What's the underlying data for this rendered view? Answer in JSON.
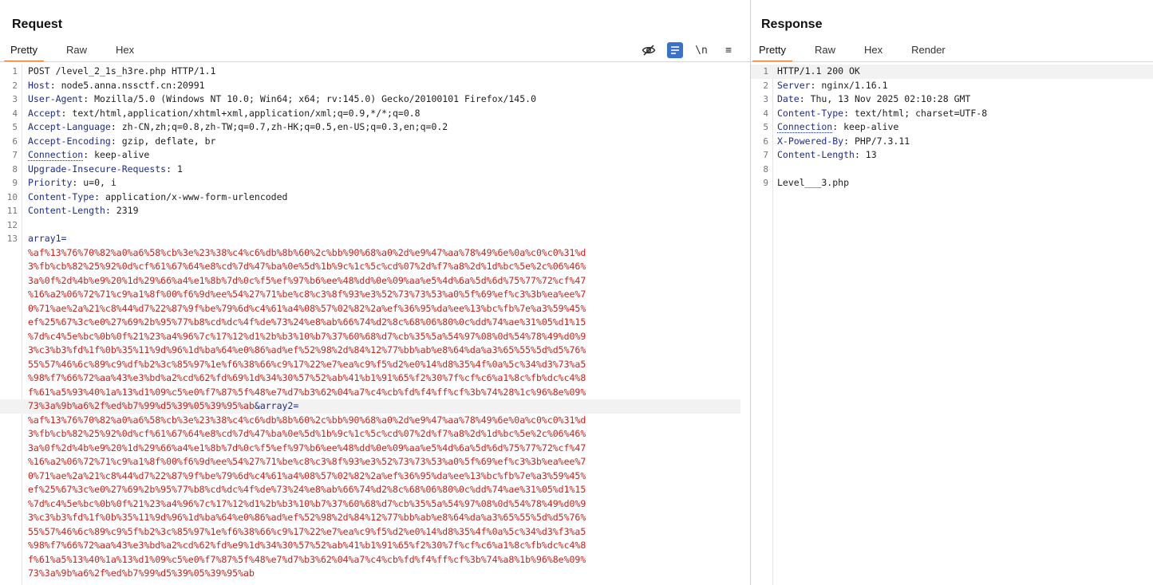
{
  "request": {
    "title": "Request",
    "tabs": [
      "Pretty",
      "Raw",
      "Hex"
    ],
    "active_tab": "Pretty",
    "toolbar": {
      "wrap_glyph": "\\n",
      "menu_glyph": "≡"
    },
    "headers": [
      {
        "n": "1",
        "key": "",
        "value": "POST /level_2_1s_h3re.php HTTP/1.1"
      },
      {
        "n": "2",
        "key": "Host",
        "value": " node5.anna.nssctf.cn:20991"
      },
      {
        "n": "3",
        "key": "User-Agent",
        "value": " Mozilla/5.0 (Windows NT 10.0; Win64; x64; rv:145.0) Gecko/20100101 Firefox/145.0"
      },
      {
        "n": "4",
        "key": "Accept",
        "value": " text/html,application/xhtml+xml,application/xml;q=0.9,*/*;q=0.8"
      },
      {
        "n": "5",
        "key": "Accept-Language",
        "value": " zh-CN,zh;q=0.8,zh-TW;q=0.7,zh-HK;q=0.5,en-US;q=0.3,en;q=0.2"
      },
      {
        "n": "6",
        "key": "Accept-Encoding",
        "value": " gzip, deflate, br"
      },
      {
        "n": "7",
        "key": "Connection",
        "value": " keep-alive"
      },
      {
        "n": "8",
        "key": "Upgrade-Insecure-Requests",
        "value": " 1"
      },
      {
        "n": "9",
        "key": "Priority",
        "value": " u=0, i"
      },
      {
        "n": "10",
        "key": "Content-Type",
        "value": " application/x-www-form-urlencoded"
      },
      {
        "n": "11",
        "key": "Content-Length",
        "value": " 2319"
      },
      {
        "n": "12",
        "key": "",
        "value": ""
      }
    ],
    "body_line_number": "13",
    "body_first_key": "array1=",
    "body_separator": "&",
    "body_second_key": "array2=",
    "array1_lines": [
      "%af%13%76%70%82%a0%a6%58%cb%3e%23%38%c4%c6%db%8b%60%2c%bb%90%68%a0%2d%e9%47%aa%78%49%6e%0a%c0%c0%31%d",
      "3%fb%cb%82%25%92%0d%cf%61%67%64%e8%cd%7d%47%ba%0e%5d%1b%9c%1c%5c%cd%07%2d%f7%a8%2d%1d%bc%5e%2c%06%46%",
      "3a%0f%2d%4b%e9%20%1d%29%66%a4%e1%8b%7d%0c%f5%ef%97%b6%ee%48%dd%0e%09%aa%e5%4d%6a%5d%6d%75%77%72%cf%47",
      "%16%a2%06%72%71%c9%a1%8f%00%f6%9d%ee%54%27%71%be%c8%c3%8f%93%e3%52%73%73%53%a0%5f%69%ef%c3%3b%ea%ee%7",
      "0%71%ae%2a%21%c8%44%d7%22%87%9f%be%79%6d%c4%61%a4%08%57%02%82%2a%ef%36%95%da%ee%13%bc%fb%7e%a3%59%45%",
      "ef%25%67%3c%e0%27%69%2b%95%77%b8%cd%dc%4f%de%73%24%e8%ab%66%74%d2%8c%68%06%80%0c%dd%74%ae%31%05%d1%15",
      "%7d%c4%5e%bc%0b%0f%21%23%a4%96%7c%17%12%d1%2b%b3%10%b7%37%60%68%d7%cb%35%5a%54%97%08%0d%54%78%49%d0%9",
      "3%c3%b3%fd%1f%0b%35%11%9d%96%1d%ba%64%e0%86%ad%ef%52%98%2d%84%12%77%bb%ab%e8%64%da%a3%65%55%5d%d5%76%",
      "55%57%46%6c%89%c9%df%b2%3c%85%97%1e%f6%38%66%c9%17%22%e7%ea%c9%f5%d2%e0%14%d8%35%4f%0a%5c%34%d3%73%a5",
      "%98%f7%66%72%aa%43%e3%bd%a2%cd%62%fd%69%1d%34%30%57%52%ab%41%b1%91%65%f2%30%7f%cf%c6%a1%8c%fb%dc%c4%8",
      "f%61%a5%93%40%1a%13%d1%09%c5%e0%f7%87%5f%48%e7%d7%b3%62%04%a7%c4%cb%fd%f4%ff%cf%3b%74%28%1c%96%8e%09%",
      "73%3a%9b%a6%2f%ed%b7%99%d5%39%05%39%95%ab"
    ],
    "array2_lines": [
      "%af%13%76%70%82%a0%a6%58%cb%3e%23%38%c4%c6%db%8b%60%2c%bb%90%68%a0%2d%e9%47%aa%78%49%6e%0a%c0%c0%31%d",
      "3%fb%cb%82%25%92%0d%cf%61%67%64%e8%cd%7d%47%ba%0e%5d%1b%9c%1c%5c%cd%07%2d%f7%a8%2d%1d%bc%5e%2c%06%46%",
      "3a%0f%2d%4b%e9%20%1d%29%66%a4%e1%8b%7d%0c%f5%ef%97%b6%ee%48%dd%0e%09%aa%e5%4d%6a%5d%6d%75%77%72%cf%47",
      "%16%a2%06%72%71%c9%a1%8f%00%f6%9d%ee%54%27%71%be%c8%c3%8f%93%e3%52%73%73%53%a0%5f%69%ef%c3%3b%ea%ee%7",
      "0%71%ae%2a%21%c8%44%d7%22%87%9f%be%79%6d%c4%61%a4%08%57%02%82%2a%ef%36%95%da%ee%13%bc%fb%7e%a3%59%45%",
      "ef%25%67%3c%e0%27%69%2b%95%77%b8%cd%dc%4f%de%73%24%e8%ab%66%74%d2%8c%68%06%80%0c%dd%74%ae%31%05%d1%15",
      "%7d%c4%5e%bc%0b%0f%21%23%a4%96%7c%17%12%d1%2b%b3%10%b7%37%60%68%d7%cb%35%5a%54%97%08%0d%54%78%49%d0%9",
      "3%c3%b3%fd%1f%0b%35%11%9d%96%1d%ba%64%e0%86%ad%ef%52%98%2d%84%12%77%bb%ab%e8%64%da%a3%65%55%5d%d5%76%",
      "55%57%46%6c%89%c9%5f%b2%3c%85%97%1e%f6%38%66%c9%17%22%e7%ea%c9%f5%d2%e0%14%d8%35%4f%0a%5c%34%d3%f3%a5",
      "%98%f7%66%72%aa%43%e3%bd%a2%cd%62%fd%e9%1d%34%30%57%52%ab%41%b1%91%65%f2%30%7f%cf%c6%a1%8c%fb%dc%c4%8",
      "f%61%a5%13%40%1a%13%d1%09%c5%e0%f7%87%5f%48%e7%d7%b3%62%04%a7%c4%cb%fd%f4%ff%cf%3b%74%a8%1b%96%8e%09%",
      "73%3a%9b%a6%2f%ed%b7%99%d5%39%05%39%95%ab"
    ]
  },
  "response": {
    "title": "Response",
    "tabs": [
      "Pretty",
      "Raw",
      "Hex",
      "Render"
    ],
    "active_tab": "Pretty",
    "lines": [
      {
        "n": "1",
        "key": "",
        "value": "HTTP/1.1 200 OK"
      },
      {
        "n": "2",
        "key": "Server",
        "value": " nginx/1.16.1"
      },
      {
        "n": "3",
        "key": "Date",
        "value": " Thu, 13 Nov 2025 02:10:28 GMT"
      },
      {
        "n": "4",
        "key": "Content-Type",
        "value": " text/html; charset=UTF-8"
      },
      {
        "n": "5",
        "key": "Connection",
        "value": " keep-alive"
      },
      {
        "n": "6",
        "key": "X-Powered-By",
        "value": " PHP/7.3.11"
      },
      {
        "n": "7",
        "key": "Content-Length",
        "value": " 13"
      },
      {
        "n": "8",
        "key": "",
        "value": ""
      },
      {
        "n": "9",
        "key": "",
        "value": "Level___3.php"
      }
    ]
  },
  "colors": {
    "accent": "#e8702a",
    "header_key": "#1f2d8a",
    "encoded": "#c0251f",
    "toolbar_active": "#3b72c9"
  }
}
